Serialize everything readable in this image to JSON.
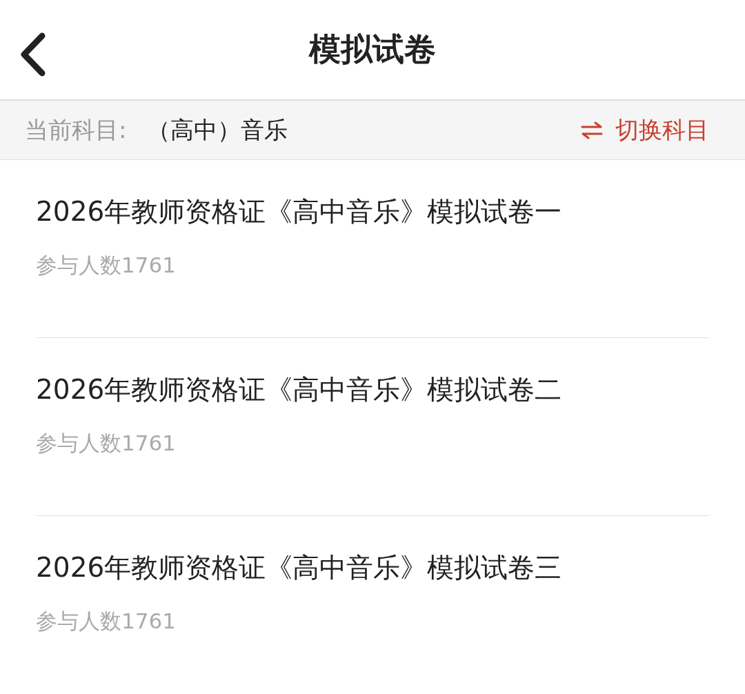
{
  "header": {
    "title": "模拟试卷"
  },
  "subject_bar": {
    "label": "当前科目:",
    "value": "（高中）音乐",
    "switch_link": "切换科目"
  },
  "papers": [
    {
      "title": "2026年教师资格证《高中音乐》模拟试卷一",
      "participants": "参与人数1761"
    },
    {
      "title": "2026年教师资格证《高中音乐》模拟试卷二",
      "participants": "参与人数1761"
    },
    {
      "title": "2026年教师资格证《高中音乐》模拟试卷三",
      "participants": "参与人数1761"
    }
  ]
}
